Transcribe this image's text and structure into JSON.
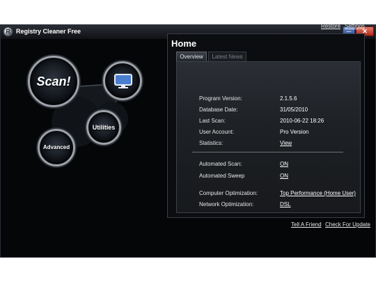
{
  "window": {
    "title": "Registry Cleaner Free",
    "app_icon": "R"
  },
  "header_links": {
    "restore": "Restore",
    "settings": "Settings"
  },
  "orbs": {
    "scan": "Scan!",
    "utilities": "Utilities",
    "advanced": "Advanced"
  },
  "home": {
    "title": "Home",
    "tabs": [
      "Overview",
      "Latest News"
    ],
    "info": [
      {
        "label": "Program Version:",
        "value": "2.1.5.6"
      },
      {
        "label": "Database Date:",
        "value": "31/05/2010"
      },
      {
        "label": "Last Scan:",
        "value": "2010-06-22 18:26"
      },
      {
        "label": "User Account:",
        "value": "Pro Version"
      },
      {
        "label": "Statistics:",
        "value": "View"
      }
    ],
    "settings": [
      {
        "label": "Automated Scan:",
        "value": "ON"
      },
      {
        "label": "Automated Sweep",
        "value": "ON"
      },
      {
        "label": "Computer Optimization:",
        "value": "Top Performance (Home User)"
      },
      {
        "label": "Network Optimization:",
        "value": "DSL"
      }
    ]
  },
  "footer_links": {
    "tell_friend": "Tell A Friend",
    "check_update": "Check For Update"
  }
}
